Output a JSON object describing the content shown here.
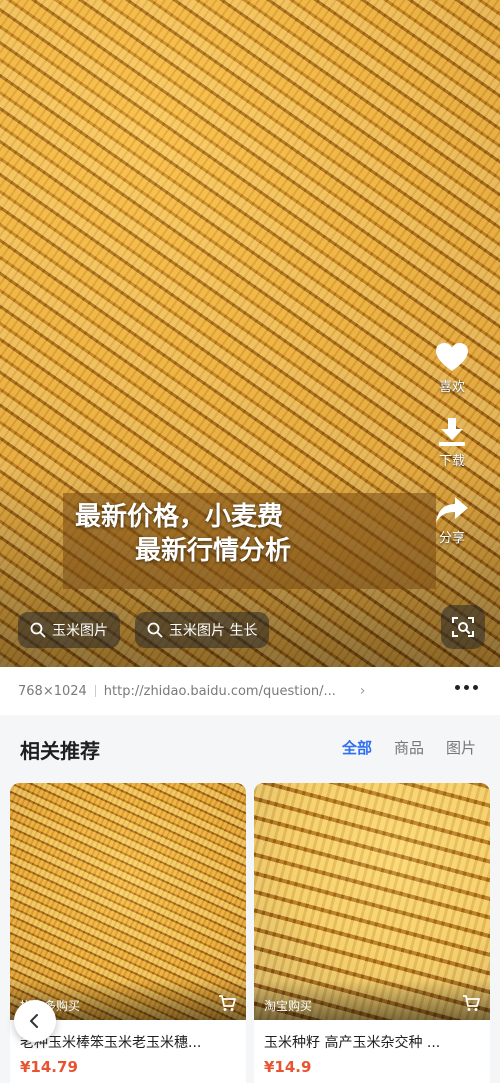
{
  "hero": {
    "overlay_title_line1": "最新价格，小麦费",
    "overlay_title_line2": "最新行情分析",
    "actions": [
      {
        "label": "喜欢",
        "icon": "heart-icon"
      },
      {
        "label": "下载",
        "icon": "download-icon"
      },
      {
        "label": "分享",
        "icon": "share-icon"
      }
    ],
    "chips": [
      {
        "label": "玉米图片",
        "icon": "search-icon"
      },
      {
        "label": "玉米图片 生长",
        "icon": "search-icon"
      }
    ],
    "scan_icon": "scan-icon"
  },
  "source": {
    "dimensions": "768×1024",
    "url": "http://zhidao.baidu.com/question/...",
    "chevron": "›"
  },
  "related": {
    "title": "相关推荐",
    "tabs": [
      {
        "label": "全部",
        "active": true
      },
      {
        "label": "商品",
        "active": false
      },
      {
        "label": "图片",
        "active": false
      }
    ],
    "active_color": "#2f6ff2"
  },
  "products": [
    {
      "source": "拼多多购买",
      "title": "老种玉米棒笨玉米老玉米穗...",
      "price": "¥14.79"
    },
    {
      "source": "淘宝购买",
      "title": "玉米种籽 高产玉米杂交种 ...",
      "price": "¥14.9"
    }
  ],
  "colors": {
    "price": "#e8542f",
    "accent": "#2f6ff2"
  }
}
